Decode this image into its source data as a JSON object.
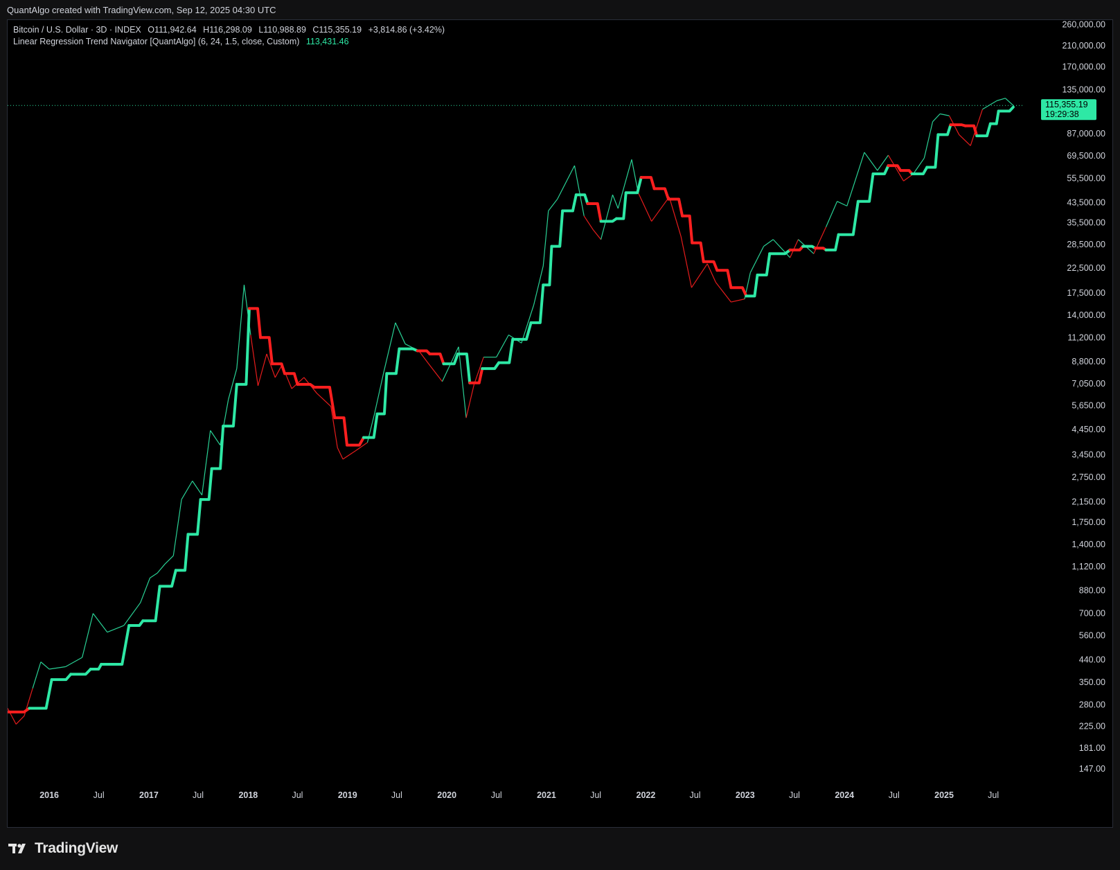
{
  "header": {
    "attribution": "QuantAlgo created with TradingView.com, Sep 12, 2025 04:30 UTC"
  },
  "legend": {
    "line1": {
      "symbol": "Bitcoin / U.S. Dollar · 3D · INDEX",
      "open": "O111,942.64",
      "high": "H116,298.09",
      "low": "L110,988.89",
      "close": "C115,355.19",
      "change": "+3,814.86 (+3.42%)"
    },
    "line2": {
      "indicator": "Linear Regression Trend Navigator [QuantAlgo] (6, 24, 1.5, close, Custom)",
      "value": "113,431.46"
    }
  },
  "price_badge": {
    "price": "115,355.19",
    "countdown": "19:29:38"
  },
  "footer": {
    "logo_text": "TradingView"
  },
  "colors": {
    "bull": "#2ee8a5",
    "bear": "#ff1f1f",
    "background": "#000000",
    "badge": "#2ee8a5"
  },
  "chart_data": {
    "type": "line",
    "y_scale": "log",
    "ylim": [
      120,
      272000
    ],
    "y_ticks": [
      {
        "v": 260000,
        "label": "260,000.00"
      },
      {
        "v": 210000,
        "label": "210,000.00"
      },
      {
        "v": 170000,
        "label": "170,000.00"
      },
      {
        "v": 135000,
        "label": "135,000.00"
      },
      {
        "v": 87000,
        "label": "87,000.00"
      },
      {
        "v": 69500,
        "label": "69,500.00"
      },
      {
        "v": 55500,
        "label": "55,500.00"
      },
      {
        "v": 43500,
        "label": "43,500.00"
      },
      {
        "v": 35500,
        "label": "35,500.00"
      },
      {
        "v": 28500,
        "label": "28,500.00"
      },
      {
        "v": 22500,
        "label": "22,500.00"
      },
      {
        "v": 17500,
        "label": "17,500.00"
      },
      {
        "v": 14000,
        "label": "14,000.00"
      },
      {
        "v": 11200,
        "label": "11,200.00"
      },
      {
        "v": 8800,
        "label": "8,800.00"
      },
      {
        "v": 7050,
        "label": "7,050.00"
      },
      {
        "v": 5650,
        "label": "5,650.00"
      },
      {
        "v": 4450,
        "label": "4,450.00"
      },
      {
        "v": 3450,
        "label": "3,450.00"
      },
      {
        "v": 2750,
        "label": "2,750.00"
      },
      {
        "v": 2150,
        "label": "2,150.00"
      },
      {
        "v": 1750,
        "label": "1,750.00"
      },
      {
        "v": 1400,
        "label": "1,400.00"
      },
      {
        "v": 1120,
        "label": "1,120.00"
      },
      {
        "v": 880,
        "label": "880.00"
      },
      {
        "v": 700,
        "label": "700.00"
      },
      {
        "v": 560,
        "label": "560.00"
      },
      {
        "v": 440,
        "label": "440.00"
      },
      {
        "v": 350,
        "label": "350.00"
      },
      {
        "v": 280,
        "label": "280.00"
      },
      {
        "v": 225,
        "label": "225.00"
      },
      {
        "v": 181,
        "label": "181.00"
      },
      {
        "v": 147,
        "label": "147.00"
      }
    ],
    "xlim": [
      "2015-08-01",
      "2025-09-20"
    ],
    "x_ticks": [
      {
        "date": "2016-01-01",
        "label": "2016",
        "year": true
      },
      {
        "date": "2016-07-01",
        "label": "Jul",
        "year": false
      },
      {
        "date": "2017-01-01",
        "label": "2017",
        "year": true
      },
      {
        "date": "2017-07-01",
        "label": "Jul",
        "year": false
      },
      {
        "date": "2018-01-01",
        "label": "2018",
        "year": true
      },
      {
        "date": "2018-07-01",
        "label": "Jul",
        "year": false
      },
      {
        "date": "2019-01-01",
        "label": "2019",
        "year": true
      },
      {
        "date": "2019-07-01",
        "label": "Jul",
        "year": false
      },
      {
        "date": "2020-01-01",
        "label": "2020",
        "year": true
      },
      {
        "date": "2020-07-01",
        "label": "Jul",
        "year": false
      },
      {
        "date": "2021-01-01",
        "label": "2021",
        "year": true
      },
      {
        "date": "2021-07-01",
        "label": "Jul",
        "year": false
      },
      {
        "date": "2022-01-01",
        "label": "2022",
        "year": true
      },
      {
        "date": "2022-07-01",
        "label": "Jul",
        "year": false
      },
      {
        "date": "2023-01-01",
        "label": "2023",
        "year": true
      },
      {
        "date": "2023-07-01",
        "label": "Jul",
        "year": false
      },
      {
        "date": "2024-01-01",
        "label": "2024",
        "year": true
      },
      {
        "date": "2024-07-01",
        "label": "Jul",
        "year": false
      },
      {
        "date": "2025-01-01",
        "label": "2025",
        "year": true
      },
      {
        "date": "2025-07-01",
        "label": "Jul",
        "year": false
      }
    ],
    "last_price": 115355.19,
    "series": [
      {
        "x": [
          "2015-08-01",
          "2015-09-01",
          "2015-10-01",
          "2015-11-01",
          "2015-12-01",
          "2016-01-01",
          "2016-03-01",
          "2016-05-01",
          "2016-06-10",
          "2016-08-01",
          "2016-10-01",
          "2016-12-01",
          "2017-01-05",
          "2017-02-01",
          "2017-03-01",
          "2017-04-01",
          "2017-05-01",
          "2017-06-10",
          "2017-07-15",
          "2017-08-15",
          "2017-09-20",
          "2017-10-20",
          "2017-11-20",
          "2017-12-17",
          "2018-01-10",
          "2018-02-06",
          "2018-03-10",
          "2018-04-10",
          "2018-05-05",
          "2018-06-10",
          "2018-07-25",
          "2018-09-10",
          "2018-11-01",
          "2018-11-25",
          "2018-12-15",
          "2019-02-01",
          "2019-03-15",
          "2019-04-10",
          "2019-05-15",
          "2019-06-26",
          "2019-08-01",
          "2019-09-20",
          "2019-10-26",
          "2019-12-15",
          "2020-02-13",
          "2020-03-12",
          "2020-04-10",
          "2020-05-15",
          "2020-07-01",
          "2020-08-15",
          "2020-10-01",
          "2020-11-15",
          "2020-12-20",
          "2021-01-08",
          "2021-02-10",
          "2021-04-14",
          "2021-05-19",
          "2021-06-22",
          "2021-07-20",
          "2021-09-01",
          "2021-09-21",
          "2021-11-10",
          "2021-12-04",
          "2022-01-22",
          "2022-03-28",
          "2022-05-10",
          "2022-06-18",
          "2022-08-15",
          "2022-09-15",
          "2022-11-10",
          "2022-12-30",
          "2023-01-20",
          "2023-03-10",
          "2023-04-14",
          "2023-06-15",
          "2023-07-15",
          "2023-09-10",
          "2023-10-25",
          "2023-12-05",
          "2024-01-10",
          "2024-03-14",
          "2024-05-01",
          "2024-06-10",
          "2024-08-05",
          "2024-09-10",
          "2024-10-20",
          "2024-11-20",
          "2024-12-17",
          "2025-01-20",
          "2025-02-25",
          "2025-04-08",
          "2025-05-22",
          "2025-07-14",
          "2025-08-14",
          "2025-09-12"
        ],
        "y": [
          270,
          230,
          250,
          330,
          430,
          400,
          410,
          450,
          700,
          580,
          620,
          780,
          1000,
          1050,
          1150,
          1250,
          2200,
          2650,
          2300,
          4400,
          3800,
          6000,
          8200,
          19000,
          11500,
          6900,
          9500,
          7500,
          8500,
          6700,
          7500,
          6400,
          5600,
          3700,
          3300,
          3600,
          3900,
          5200,
          8000,
          13000,
          10500,
          9800,
          8600,
          7200,
          10200,
          5000,
          7000,
          9200,
          9200,
          11500,
          10600,
          15500,
          23000,
          40000,
          45000,
          63000,
          38000,
          33000,
          30000,
          47000,
          41000,
          67000,
          48000,
          36000,
          46000,
          31000,
          18500,
          23500,
          19500,
          16000,
          16500,
          21500,
          28000,
          30000,
          25000,
          30000,
          26000,
          34000,
          44000,
          42000,
          72000,
          60000,
          70000,
          54000,
          58000,
          68000,
          98000,
          106000,
          104000,
          86000,
          77000,
          111000,
          121000,
          124000,
          115355.19
        ]
      },
      {
        "x": [
          "2015-08-01",
          "2015-10-20",
          "2016-01-10",
          "2016-03-20",
          "2016-06-01",
          "2016-07-10",
          "2016-10-20",
          "2016-12-10",
          "2017-02-10",
          "2017-04-10",
          "2017-05-25",
          "2017-07-10",
          "2017-08-20",
          "2017-10-01",
          "2017-11-20",
          "2018-01-05",
          "2018-02-15",
          "2018-03-30",
          "2018-05-15",
          "2018-07-01",
          "2018-09-01",
          "2018-11-15",
          "2018-12-30",
          "2019-03-01",
          "2019-04-20",
          "2019-05-25",
          "2019-07-10",
          "2019-09-15",
          "2019-10-30",
          "2019-12-20",
          "2020-02-10",
          "2020-03-25",
          "2020-05-10",
          "2020-07-10",
          "2020-08-30",
          "2020-11-05",
          "2020-12-20",
          "2021-01-20",
          "2021-03-01",
          "2021-04-20",
          "2021-06-01",
          "2021-07-20",
          "2021-09-15",
          "2021-10-20",
          "2021-12-15",
          "2022-02-01",
          "2022-03-25",
          "2022-05-15",
          "2022-06-20",
          "2022-08-01",
          "2022-09-20",
          "2022-11-10",
          "2023-01-05",
          "2023-02-15",
          "2023-04-01",
          "2023-06-15",
          "2023-08-01",
          "2023-09-15",
          "2023-10-25",
          "2023-12-10",
          "2024-02-20",
          "2024-04-15",
          "2024-06-10",
          "2024-07-25",
          "2024-09-05",
          "2024-10-30",
          "2024-12-10",
          "2025-01-25",
          "2025-03-20",
          "2025-05-01",
          "2025-06-20",
          "2025-07-20",
          "2025-09-12"
        ],
        "y": [
          260,
          270,
          360,
          380,
          400,
          420,
          620,
          650,
          920,
          1080,
          1550,
          2200,
          3000,
          4600,
          7000,
          15000,
          11200,
          8600,
          7800,
          7000,
          6800,
          5000,
          3800,
          4100,
          5200,
          7800,
          10000,
          9800,
          9500,
          8600,
          9500,
          7100,
          8200,
          8700,
          11000,
          13000,
          19000,
          28000,
          40000,
          47000,
          43000,
          36000,
          37000,
          48000,
          56000,
          50000,
          45000,
          38000,
          29000,
          24000,
          22000,
          18500,
          17000,
          21000,
          26000,
          27000,
          28000,
          27500,
          27000,
          31500,
          44000,
          58000,
          63000,
          60000,
          58000,
          62000,
          86000,
          95000,
          94000,
          85000,
          96000,
          109000,
          113431.46
        ],
        "color_segments": [
          {
            "from": "2015-08-01",
            "to": "2015-10-20",
            "trend": "bear"
          },
          {
            "from": "2015-10-20",
            "to": "2018-01-05",
            "trend": "bull"
          },
          {
            "from": "2018-01-05",
            "to": "2019-03-01",
            "trend": "bear"
          },
          {
            "from": "2019-03-01",
            "to": "2019-09-15",
            "trend": "bull"
          },
          {
            "from": "2019-09-15",
            "to": "2019-12-20",
            "trend": "bear"
          },
          {
            "from": "2019-12-20",
            "to": "2020-03-25",
            "trend": "bull"
          },
          {
            "from": "2020-03-25",
            "to": "2020-05-10",
            "trend": "bear"
          },
          {
            "from": "2020-05-10",
            "to": "2021-06-01",
            "trend": "bull"
          },
          {
            "from": "2021-06-01",
            "to": "2021-07-20",
            "trend": "bear"
          },
          {
            "from": "2021-07-20",
            "to": "2021-12-15",
            "trend": "bull"
          },
          {
            "from": "2021-12-15",
            "to": "2023-01-05",
            "trend": "bear"
          },
          {
            "from": "2023-01-05",
            "to": "2023-06-15",
            "trend": "bull"
          },
          {
            "from": "2023-06-15",
            "to": "2023-08-01",
            "trend": "bear"
          },
          {
            "from": "2023-08-01",
            "to": "2023-09-15",
            "trend": "bull"
          },
          {
            "from": "2023-09-15",
            "to": "2023-10-25",
            "trend": "bear"
          },
          {
            "from": "2023-10-25",
            "to": "2024-06-10",
            "trend": "bull"
          },
          {
            "from": "2024-06-10",
            "to": "2024-09-05",
            "trend": "bear"
          },
          {
            "from": "2024-09-05",
            "to": "2025-01-25",
            "trend": "bull"
          },
          {
            "from": "2025-01-25",
            "to": "2025-05-01",
            "trend": "bear"
          },
          {
            "from": "2025-05-01",
            "to": "2025-09-12",
            "trend": "bull"
          }
        ]
      }
    ]
  }
}
